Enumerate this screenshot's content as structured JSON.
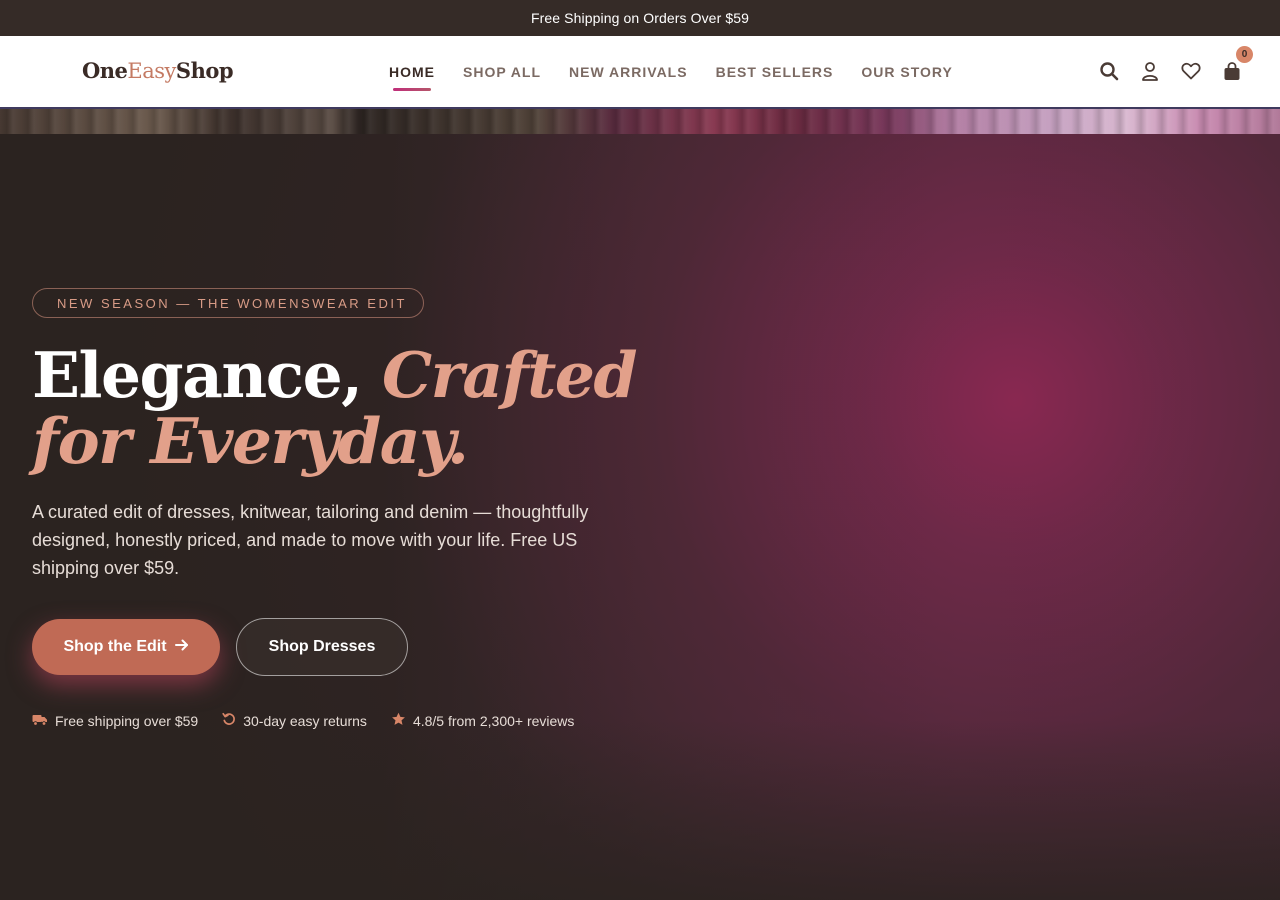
{
  "announcement": {
    "text": "Free Shipping on Orders Over $59"
  },
  "header": {
    "logo": {
      "part1": "One",
      "part2": "Easy",
      "part3": "Shop"
    },
    "nav": [
      {
        "label": "HOME",
        "active": true
      },
      {
        "label": "SHOP ALL"
      },
      {
        "label": "NEW ARRIVALS"
      },
      {
        "label": "BEST SELLERS"
      },
      {
        "label": "OUR STORY"
      }
    ],
    "icons": [
      "search-icon",
      "account-icon",
      "wishlist-icon",
      "cart-icon"
    ],
    "cart_count": "0"
  },
  "hero": {
    "eyebrow": "NEW SEASON — THE WOMENSWEAR EDIT",
    "headline_line1": "Elegance, ",
    "headline_accent1": "Crafted",
    "headline_line2": "for Everyday.",
    "description": "A curated edit of dresses, knitwear, tailoring and denim — thoughtfully designed, honestly priced, and made to move with your life. Free US shipping over $59.",
    "primary_cta": "Shop the Edit",
    "secondary_cta": "Shop Dresses",
    "perks": [
      {
        "icon": "truck-icon",
        "text": "Free shipping over $59"
      },
      {
        "icon": "returns-icon",
        "text": "30-day easy returns"
      },
      {
        "icon": "star-icon",
        "text": "4.8/5 from 2,300+ reviews"
      }
    ]
  },
  "colors": {
    "accent": "#c06a55",
    "accent_light": "#e2a08a",
    "dark": "#2b2320",
    "magenta": "#c02e7a"
  }
}
